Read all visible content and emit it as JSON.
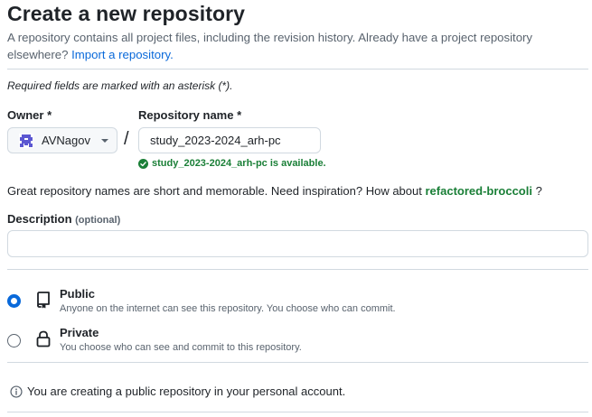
{
  "header": {
    "title": "Create a new repository",
    "subtitle": "A repository contains all project files, including the revision history. Already have a project repository elsewhere?",
    "import_link": "Import a repository."
  },
  "required_note": "Required fields are marked with an asterisk (*).",
  "owner": {
    "label": "Owner *",
    "value": "AVNagov"
  },
  "separator": "/",
  "repo_name": {
    "label": "Repository name *",
    "value": "study_2023-2024_arh-pc",
    "availability": "study_2023-2024_arh-pc is available."
  },
  "inspiration": {
    "text": "Great repository names are short and memorable. Need inspiration? How about",
    "suggestion": "refactored-broccoli",
    "suffix": "?"
  },
  "description": {
    "label": "Description",
    "optional": "(optional)",
    "value": ""
  },
  "visibility": {
    "options": [
      {
        "title": "Public",
        "desc": "Anyone on the internet can see this repository. You choose who can commit.",
        "checked": true,
        "icon": "repo-icon"
      },
      {
        "title": "Private",
        "desc": "You choose who can see and commit to this repository.",
        "checked": false,
        "icon": "lock-icon"
      }
    ]
  },
  "notice": "You are creating a public repository in your personal account.",
  "colors": {
    "accent": "#0969da",
    "success": "#1a7f37",
    "border": "#d1d9e0",
    "muted": "#59636e"
  }
}
